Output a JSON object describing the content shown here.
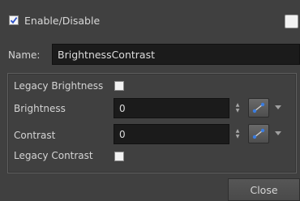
{
  "header": {
    "enable_label": "Enable/Disable",
    "enable_checked": true,
    "extra_checkbox_checked": false
  },
  "name": {
    "label": "Name:",
    "value": "BrightnessContrast"
  },
  "parameters": {
    "legacy_brightness": {
      "label": "Legacy Brightness",
      "checked": false
    },
    "brightness": {
      "label": "Brightness",
      "value": "0"
    },
    "contrast": {
      "label": "Contrast",
      "value": "0"
    },
    "legacy_contrast": {
      "label": "Legacy Contrast",
      "checked": false
    }
  },
  "footer": {
    "close_label": "Close"
  },
  "icons": {
    "spinner_up": "▲",
    "spinner_down": "▼"
  }
}
